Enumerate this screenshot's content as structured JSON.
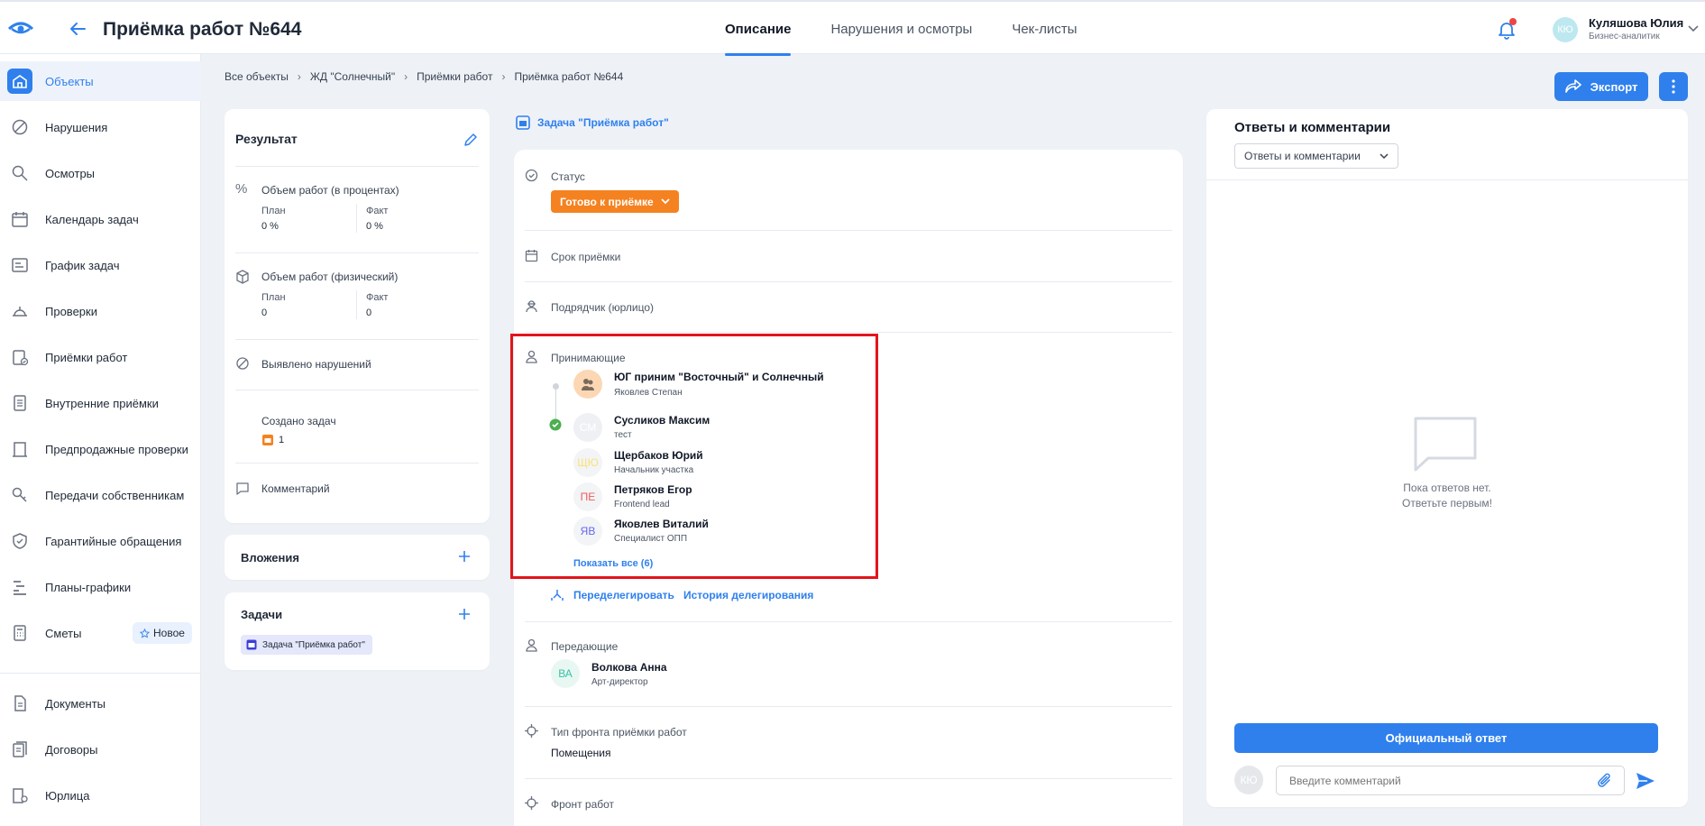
{
  "header": {
    "title": "Приёмка работ №644",
    "tabs": [
      "Описание",
      "Нарушения и осмотры",
      "Чек-листы"
    ],
    "user": {
      "initials": "КЮ",
      "name": "Куляшова Юлия",
      "role": "Бизнес-аналитик"
    }
  },
  "sidebar": {
    "items": [
      {
        "label": "Объекты",
        "icon": "building-icon"
      },
      {
        "label": "Нарушения",
        "icon": "forbidden-icon"
      },
      {
        "label": "Осмотры",
        "icon": "magnifier-icon"
      },
      {
        "label": "Календарь задач",
        "icon": "calendar-icon"
      },
      {
        "label": "График задач",
        "icon": "chart-icon"
      },
      {
        "label": "Проверки",
        "icon": "helmet-icon"
      },
      {
        "label": "Приёмки работ",
        "icon": "clipboard-check-icon"
      },
      {
        "label": "Внутренние приёмки",
        "icon": "list-icon"
      },
      {
        "label": "Предпродажные проверки",
        "icon": "door-icon"
      },
      {
        "label": "Передачи собственникам",
        "icon": "key-icon"
      },
      {
        "label": "Гарантийные обращения",
        "icon": "shield-icon"
      },
      {
        "label": "Планы-графики",
        "icon": "gantt-icon"
      },
      {
        "label": "Сметы",
        "icon": "calculator-icon"
      },
      {
        "label": "Документы",
        "icon": "document-icon"
      },
      {
        "label": "Договоры",
        "icon": "contracts-icon"
      },
      {
        "label": "Юрлица",
        "icon": "company-icon"
      }
    ],
    "new_badge": "Новое"
  },
  "breadcrumb": [
    "Все объекты",
    "ЖД \"Солнечный\"",
    "Приёмки работ",
    "Приёмка работ №644"
  ],
  "export_label": "Экспорт",
  "result": {
    "title": "Результат",
    "percent": {
      "label": "Объем работ (в процентах)",
      "plan_label": "План",
      "plan": "0 %",
      "fact_label": "Факт",
      "fact": "0 %"
    },
    "physical": {
      "label": "Объем работ (физический)",
      "plan_label": "План",
      "plan": "0",
      "fact_label": "Факт",
      "fact": "0"
    },
    "violations_label": "Выявлено нарушений",
    "created_tasks_label": "Создано задач",
    "created_tasks_count": "1",
    "comment_label": "Комментарий"
  },
  "attachments_label": "Вложения",
  "tasks": {
    "label": "Задачи",
    "chip": "Задача \"Приёмка работ\""
  },
  "task_link": "Задача \"Приёмка работ\"",
  "status": {
    "label": "Статус",
    "value": "Готово к приёмке",
    "color": "#f58220"
  },
  "deadline_label": "Срок приёмки",
  "contractor_label": "Подрядчик (юрлицо)",
  "receivers": {
    "label": "Принимающие",
    "people": [
      {
        "initials": "",
        "name": "ЮГ приним \"Восточный\" и Солнечный",
        "role": "Яковлев Степан"
      },
      {
        "initials": "СМ",
        "name": "Сусликов Максим",
        "role": "тест"
      },
      {
        "initials": "ЩЮ",
        "name": "Щербаков Юрий",
        "role": "Начальник участка"
      },
      {
        "initials": "ПЕ",
        "name": "Петряков Егор",
        "role": "Frontend lead"
      },
      {
        "initials": "ЯВ",
        "name": "Яковлев Виталий",
        "role": "Специалист ОПП"
      }
    ],
    "show_all": "Показать все (6)",
    "redelegate": "Переделегировать",
    "history": "История делегирования"
  },
  "transmitter": {
    "label": "Передающие",
    "initials": "ВА",
    "name": "Волкова Анна",
    "role": "Арт-директор"
  },
  "front_type": {
    "label": "Тип фронта приёмки работ",
    "value": "Помещения"
  },
  "front_label": "Фронт работ",
  "comments": {
    "title": "Ответы и комментарии",
    "select": "Ответы и комментарии",
    "empty_line1": "Пока ответов нет.",
    "empty_line2": "Ответьте первым!",
    "official_button": "Официальный ответ",
    "avatar": "КЮ",
    "input_placeholder": "Введите комментарий"
  },
  "colors": {
    "accent": "#2f80ed",
    "highlight": "#e3141b"
  }
}
